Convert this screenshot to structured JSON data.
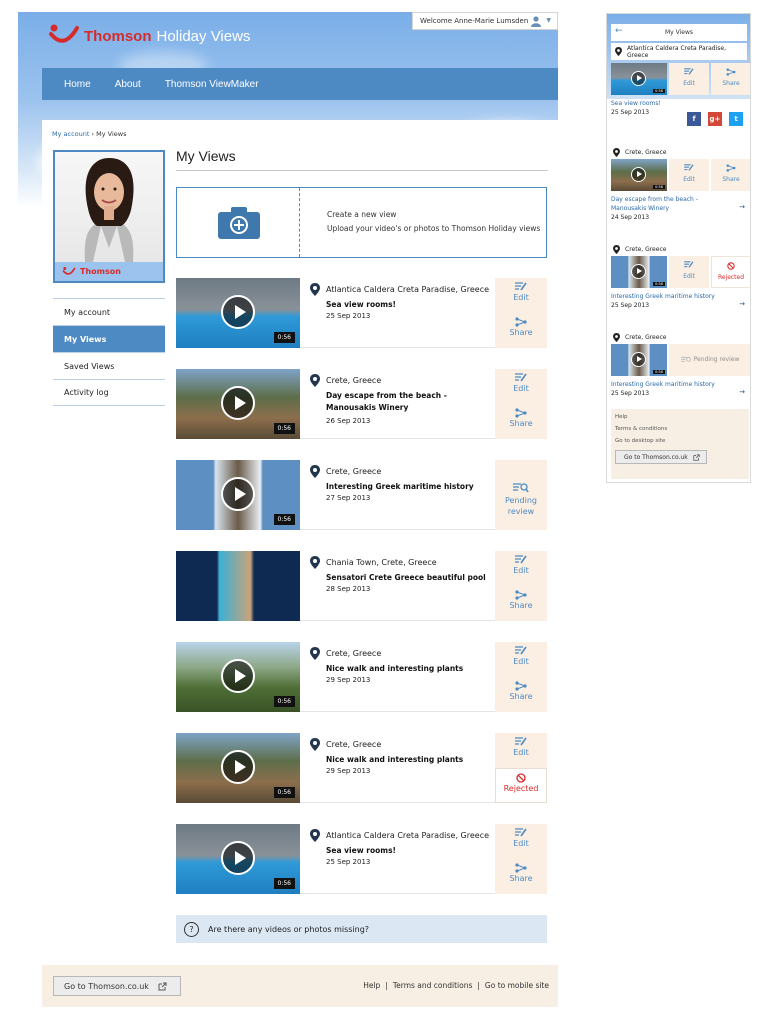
{
  "header": {
    "welcome_text": "Welcome Anne-Marie Lumsden",
    "logo_text": "Thomson",
    "logo_sub": "Holiday Views",
    "nav": [
      "Home",
      "About",
      "Thomson ViewMaker"
    ]
  },
  "breadcrumb": {
    "link": "My account",
    "sep": " › ",
    "current": "My Views"
  },
  "profile": {
    "brand": "Thomson"
  },
  "sidebar": {
    "items": [
      "My account",
      "My Views",
      "Saved Views",
      "Activity log"
    ],
    "active_index": 1
  },
  "page": {
    "title": "My Views"
  },
  "create": {
    "title": "Create a new view",
    "subtitle": "Upload your video's or photos to Thomson Holiday views"
  },
  "labels": {
    "edit": "Edit",
    "share": "Share",
    "pending": "Pending review",
    "rejected": "Rejected"
  },
  "views": [
    {
      "location": "Atlantica Caldera Creta Paradise, Greece",
      "title": "Sea view rooms!",
      "date": "25 Sep 2013",
      "duration": "0:56",
      "status": "active"
    },
    {
      "location": "Crete, Greece",
      "title": "Day escape from the beach - Manousakis Winery",
      "date": "26 Sep 2013",
      "duration": "0:56",
      "status": "active"
    },
    {
      "location": "Crete, Greece",
      "title": "Interesting Greek maritime history",
      "date": "27 Sep 2013",
      "duration": "0:56",
      "status": "pending"
    },
    {
      "location": "Chania Town, Crete, Greece",
      "title": "Sensatori Crete Greece beautiful pool",
      "date": "28 Sep 2013",
      "duration": "",
      "status": "active"
    },
    {
      "location": "Crete, Greece",
      "title": "Nice walk and interesting plants",
      "date": "29 Sep 2013",
      "duration": "0:56",
      "status": "active"
    },
    {
      "location": "Crete, Greece",
      "title": "Nice walk and interesting plants",
      "date": "29 Sep 2013",
      "duration": "0:56",
      "status": "rejected"
    },
    {
      "location": "Atlantica Caldera Creta Paradise, Greece",
      "title": "Sea view rooms!",
      "date": "25 Sep 2013",
      "duration": "0:56",
      "status": "active"
    }
  ],
  "missing": {
    "q": "?",
    "text": "Are there any videos or photos missing?"
  },
  "footer": {
    "button": "Go to Thomson.co.uk",
    "links": [
      "Help",
      "Terms and conditions",
      "Go to mobile site"
    ],
    "sep": "|"
  },
  "mobile": {
    "header": "My Views",
    "back": "←",
    "first_location": "Atlantica Caldera Creta Paradise, Greece",
    "items": [
      {
        "title": "Sea view rooms!",
        "date": "25 Sep 2013"
      },
      {
        "location": "Crete, Greece",
        "title": "Day escape from the beach - Manousakis Winery",
        "date": "24 Sep 2013"
      },
      {
        "location": "Crete, Greece",
        "title": "Interesting Greek maritime history",
        "date": "25 Sep 2013"
      },
      {
        "location": "Crete, Greece",
        "title": "Interesting Greek maritime history",
        "date": "25 Sep 2013"
      }
    ],
    "arrow": "→",
    "social": [
      "f",
      "g+",
      "t"
    ],
    "footer_links": [
      "Help",
      "Terms & conditions",
      "Go to desktop site"
    ],
    "footer_button": "Go to Thomson.co.uk"
  },
  "colors": {
    "brand_red": "#d72b2b",
    "nav_blue": "#4d8ac4",
    "action_bg": "#fbeee2",
    "link_blue": "#2b6aa8"
  }
}
